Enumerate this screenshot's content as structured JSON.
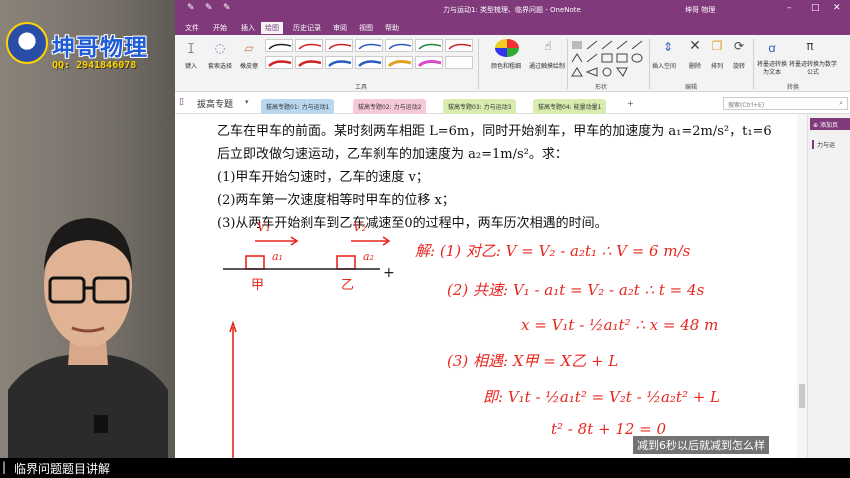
{
  "stream": {
    "brand": "坤哥物理",
    "qq": "QQ: 2941846078",
    "bottom_title": "临界问题题目讲解",
    "subtitle": "减到6秒以后就减到怎么样"
  },
  "window": {
    "title": "力与运动1: 类型梳理、临界问题 - OneNote",
    "user": "坤哥 物理"
  },
  "menus": [
    "文件",
    "开始",
    "插入",
    "绘图",
    "历史记录",
    "审阅",
    "视图",
    "帮助"
  ],
  "active_menu": "绘图",
  "ribbon": {
    "tools": [
      "键入",
      "套索选择",
      "橡皮擦"
    ],
    "tools_group": "工具",
    "color_label": "颜色和粗细",
    "ink_label": "通过触摸绘制",
    "shapes_group": "形状",
    "insert_space": "插入空间",
    "delete": "删除",
    "arrange": "排列",
    "rotate": "旋转",
    "edit_group": "编辑",
    "ink_to_text": "将墨迹转换为文本",
    "ink_to_math": "将墨迹转换为数学公式",
    "convert_group": "转换"
  },
  "notebook": {
    "name": "拔高专题",
    "tabs": [
      {
        "label": "拔高专题01: 力与运动1",
        "color": "#b9d7ef"
      },
      {
        "label": "拔高专题02: 力与运动2",
        "color": "#f6c9d6"
      },
      {
        "label": "拔高专题03: 力与运动3",
        "color": "#d9ecb0"
      },
      {
        "label": "拔高专题04: 能量动量1",
        "color": "#d9ecb0"
      }
    ],
    "search_placeholder": "搜索(Ctrl+E)"
  },
  "page_panel": {
    "add_page": "添加页",
    "entry": "力与运"
  },
  "problem": {
    "line1": "乙车在甲车的前面。某时刻两车相距 L=6m，同时开始刹车，甲车的加速度为 a₁=2m/s²，t₁=6",
    "line2": "后立即改做匀速运动，乙车刹车的加速度为 a₂=1m/s²。求：",
    "q1": "(1)甲车开始匀速时，乙车的速度 v；",
    "q2": "(2)两车第一次速度相等时甲车的位移 x；",
    "q3": "(3)从两车开始刹车到乙车减速至0的过程中，两车历次相遇的时间。"
  },
  "ink": {
    "v1": "V₁",
    "v2": "V₂",
    "a1": "a₁",
    "a2": "a₂",
    "car1": "甲",
    "car2": "乙",
    "sol_head": "解: (1) 对乙: V = V₂ - a₂t₁  ∴ V = 6 m/s",
    "sol2": "(2) 共速: V₁ - a₁t = V₂ - a₂t  ∴ t = 4s",
    "sol2b": "x = V₁t - ½a₁t²   ∴ x = 48 m",
    "sol3": "(3) 相遇: X甲 = X乙 + L",
    "sol3b": "即: V₁t - ½a₁t² = V₂t - ½a₂t² + L",
    "sol3c": "t² - 8t + 12 = 0"
  },
  "colors": {
    "onenote_purple": "#80397b",
    "ink_red": "#e8261f"
  }
}
